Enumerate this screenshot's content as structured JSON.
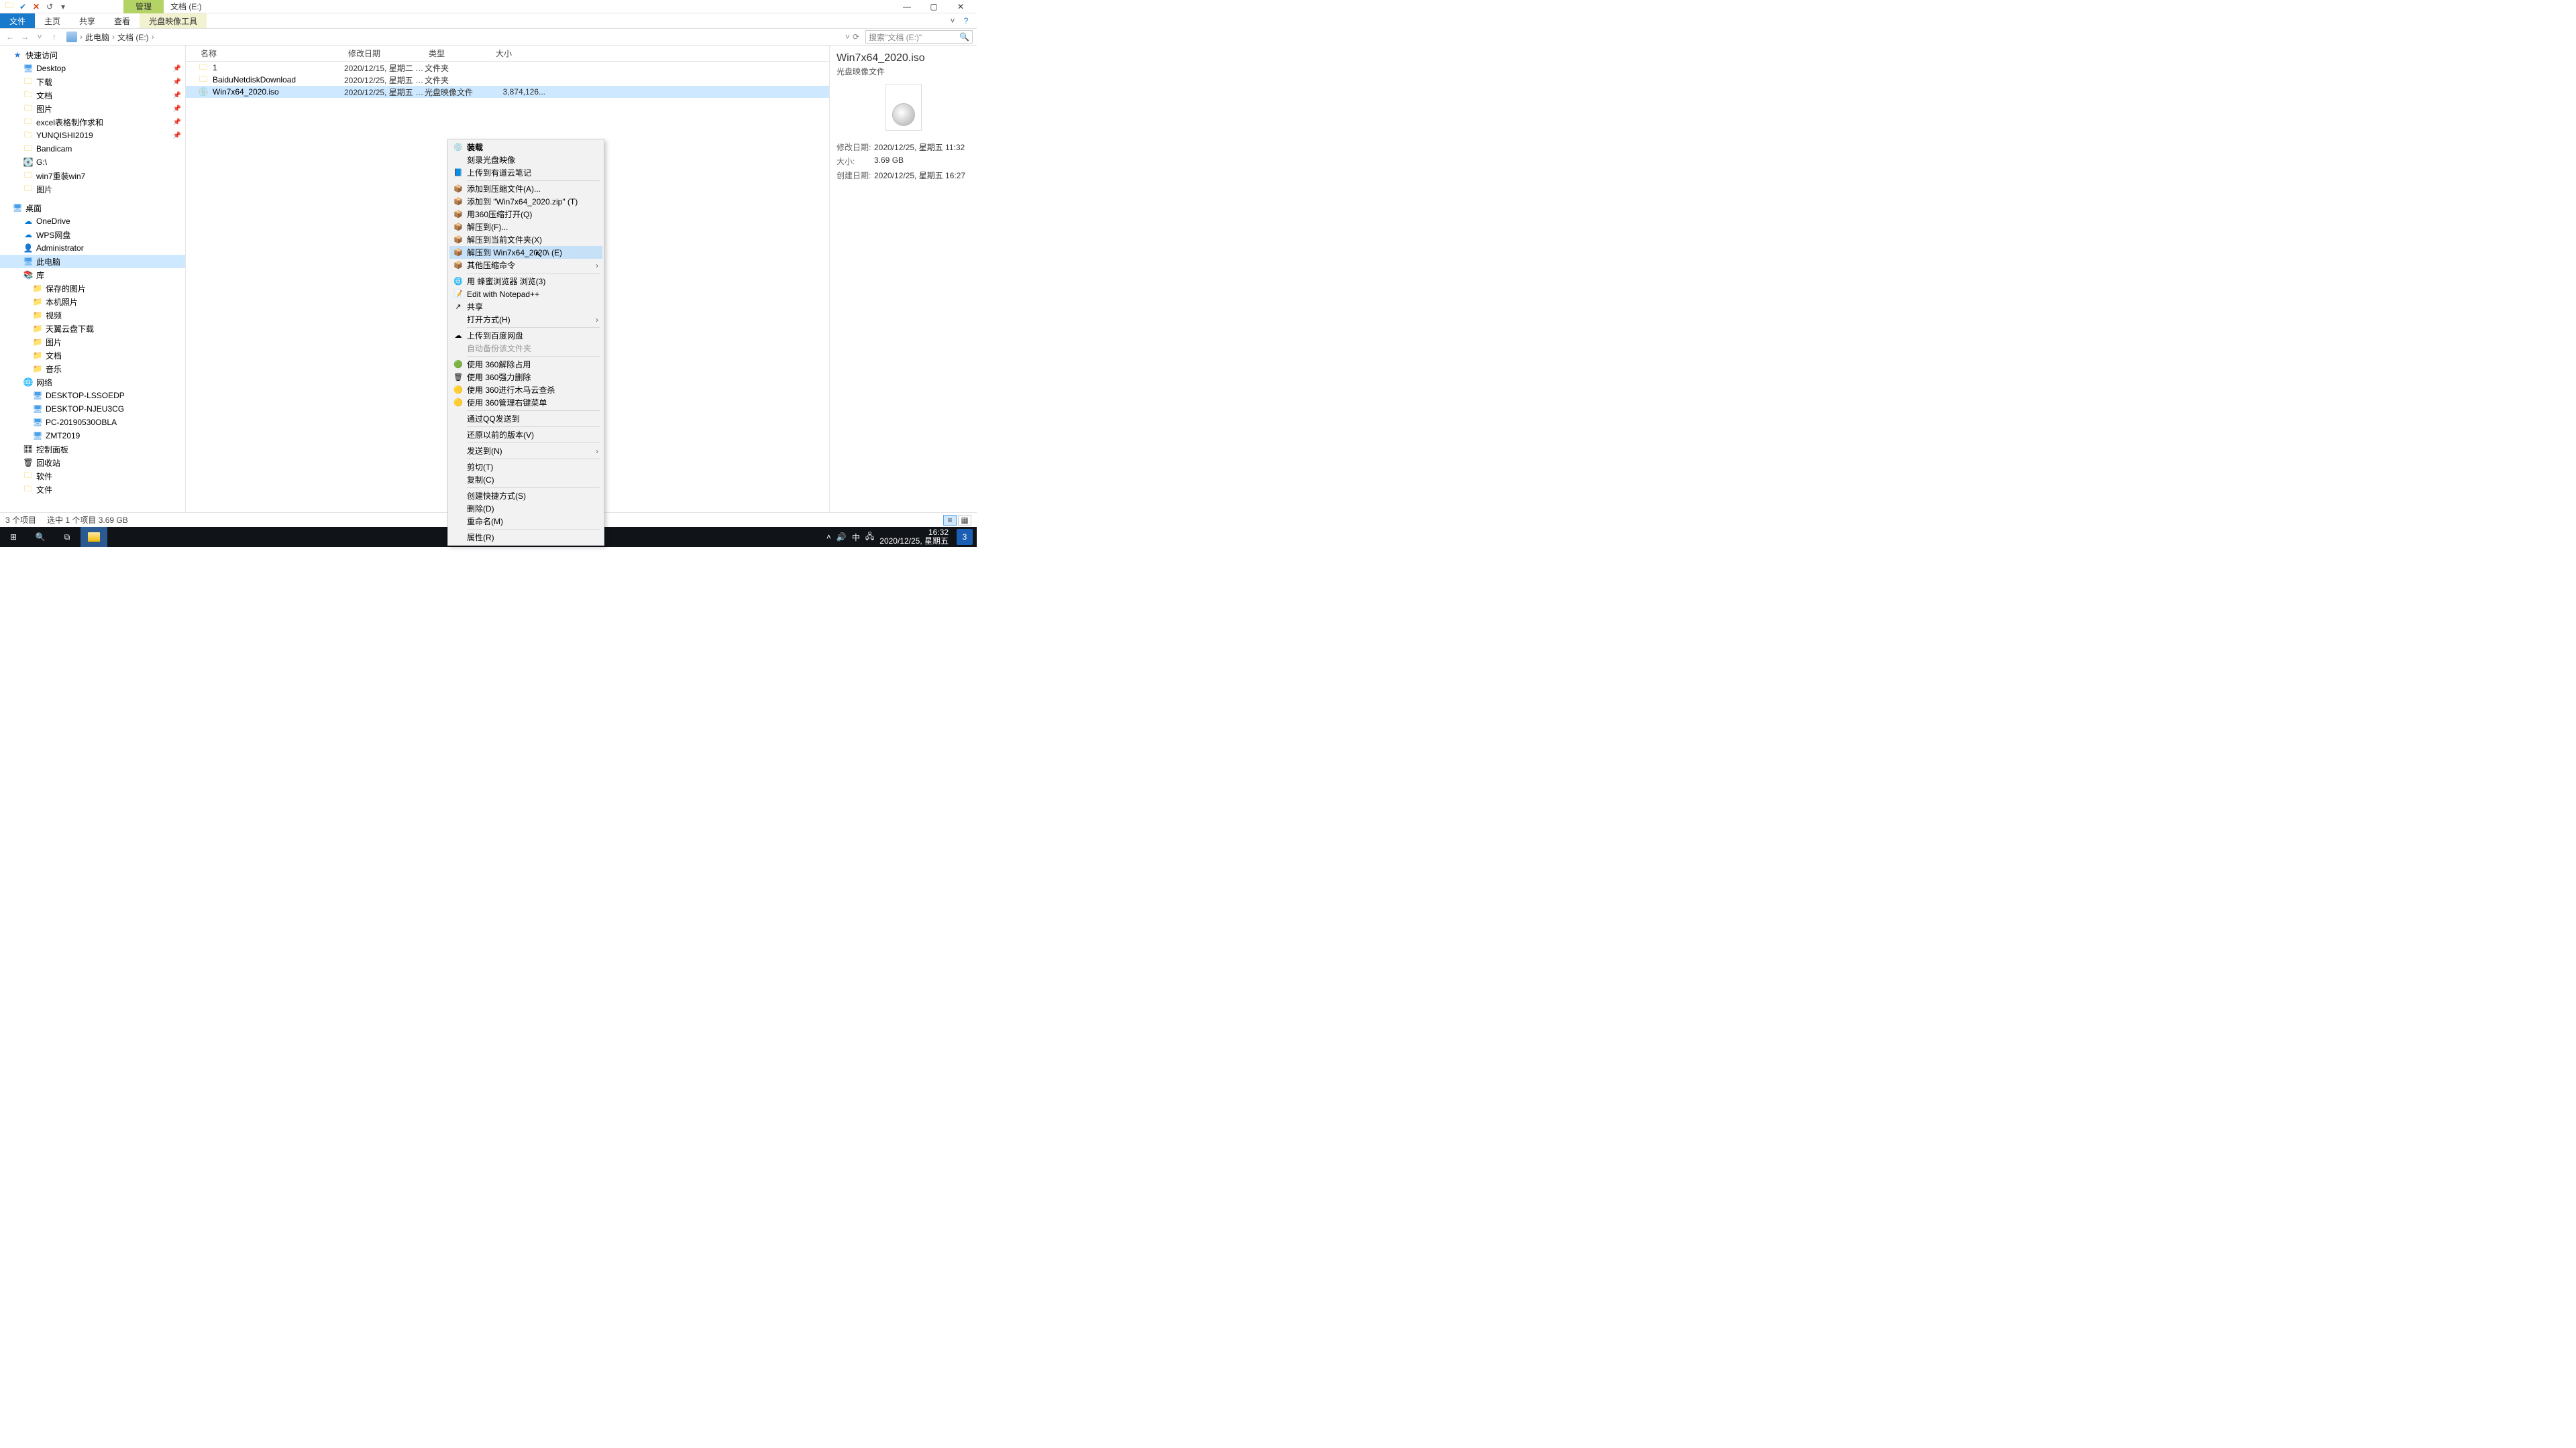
{
  "window": {
    "context_tab": "管理",
    "title": "文档 (E:)",
    "tabs": {
      "file": "文件",
      "home": "主页",
      "share": "共享",
      "view": "查看",
      "disc_tool": "光盘映像工具"
    }
  },
  "address": {
    "parts": [
      "此电脑",
      "文档 (E:)"
    ],
    "refresh": "⟳",
    "search_placeholder": "搜索\"文档 (E:)\""
  },
  "nav": {
    "quick": "快速访问",
    "quick_items": [
      {
        "icon": "desktop",
        "label": "Desktop",
        "pin": true
      },
      {
        "icon": "folder",
        "label": "下载",
        "pin": true
      },
      {
        "icon": "folder",
        "label": "文档",
        "pin": true
      },
      {
        "icon": "folder",
        "label": "图片",
        "pin": true
      },
      {
        "icon": "folder",
        "label": "excel表格制作求和",
        "pin": true
      },
      {
        "icon": "folder",
        "label": "YUNQISHI2019",
        "pin": true
      },
      {
        "icon": "folder",
        "label": "Bandicam"
      },
      {
        "icon": "disk",
        "label": "G:\\"
      },
      {
        "icon": "folder",
        "label": "win7重装win7"
      },
      {
        "icon": "folder",
        "label": "图片"
      }
    ],
    "desktop": "桌面",
    "desktop_items": [
      {
        "icon": "cloud",
        "label": "OneDrive"
      },
      {
        "icon": "cloud",
        "label": "WPS网盘"
      },
      {
        "icon": "user",
        "label": "Administrator"
      },
      {
        "icon": "monitor",
        "label": "此电脑",
        "selected": true
      },
      {
        "icon": "lib",
        "label": "库"
      }
    ],
    "lib_items": [
      {
        "label": "保存的图片"
      },
      {
        "label": "本机照片"
      },
      {
        "label": "视频"
      },
      {
        "label": "天翼云盘下载"
      },
      {
        "label": "图片"
      },
      {
        "label": "文档"
      },
      {
        "label": "音乐"
      }
    ],
    "net": "网络",
    "net_items": [
      {
        "label": "DESKTOP-LSSOEDP"
      },
      {
        "label": "DESKTOP-NJEU3CG"
      },
      {
        "label": "PC-20190530OBLA"
      },
      {
        "label": "ZMT2019"
      }
    ],
    "others": [
      {
        "icon": "panel",
        "label": "控制面板"
      },
      {
        "icon": "recycle",
        "label": "回收站"
      },
      {
        "icon": "folder",
        "label": "软件"
      },
      {
        "icon": "folder",
        "label": "文件"
      }
    ]
  },
  "columns": {
    "name": "名称",
    "date": "修改日期",
    "type": "类型",
    "size": "大小"
  },
  "rows": [
    {
      "icon": "folder",
      "name": "1",
      "date": "2020/12/15, 星期二 1...",
      "type": "文件夹",
      "size": ""
    },
    {
      "icon": "folder",
      "name": "BaiduNetdiskDownload",
      "date": "2020/12/25, 星期五 1...",
      "type": "文件夹",
      "size": ""
    },
    {
      "icon": "disc",
      "name": "Win7x64_2020.iso",
      "date": "2020/12/25, 星期五 1...",
      "type": "光盘映像文件",
      "size": "3,874,126...",
      "selected": true
    }
  ],
  "context_menu": {
    "groups": [
      [
        {
          "icon": "💿",
          "label": "装载",
          "bold": true
        },
        {
          "icon": "",
          "label": "刻录光盘映像"
        },
        {
          "icon": "📘",
          "label": "上传到有道云笔记"
        }
      ],
      [
        {
          "icon": "📦",
          "label": "添加到压缩文件(A)..."
        },
        {
          "icon": "📦",
          "label": "添加到 \"Win7x64_2020.zip\" (T)"
        },
        {
          "icon": "📦",
          "label": "用360压缩打开(Q)"
        },
        {
          "icon": "📦",
          "label": "解压到(F)..."
        },
        {
          "icon": "📦",
          "label": "解压到当前文件夹(X)"
        },
        {
          "icon": "📦",
          "label": "解压到 Win7x64_2020\\ (E)",
          "hover": true
        },
        {
          "icon": "📦",
          "label": "其他压缩命令",
          "submenu": true
        }
      ],
      [
        {
          "icon": "🌐",
          "label": "用 蜂蜜浏览器 浏览(3)"
        },
        {
          "icon": "📝",
          "label": "Edit with Notepad++"
        },
        {
          "icon": "↗",
          "label": "共享"
        },
        {
          "icon": "",
          "label": "打开方式(H)",
          "submenu": true
        }
      ],
      [
        {
          "icon": "☁",
          "label": "上传到百度网盘"
        },
        {
          "icon": "",
          "label": "自动备份该文件夹",
          "disabled": true
        }
      ],
      [
        {
          "icon": "🟢",
          "label": "使用 360解除占用"
        },
        {
          "icon": "🗑",
          "label": "使用 360强力删除"
        },
        {
          "icon": "🟡",
          "label": "使用 360进行木马云查杀"
        },
        {
          "icon": "🟡",
          "label": "使用 360管理右键菜单"
        }
      ],
      [
        {
          "icon": "",
          "label": "通过QQ发送到"
        }
      ],
      [
        {
          "icon": "",
          "label": "还原以前的版本(V)"
        }
      ],
      [
        {
          "icon": "",
          "label": "发送到(N)",
          "submenu": true
        }
      ],
      [
        {
          "icon": "",
          "label": "剪切(T)"
        },
        {
          "icon": "",
          "label": "复制(C)"
        }
      ],
      [
        {
          "icon": "",
          "label": "创建快捷方式(S)"
        },
        {
          "icon": "",
          "label": "删除(D)"
        },
        {
          "icon": "",
          "label": "重命名(M)"
        }
      ],
      [
        {
          "icon": "",
          "label": "属性(R)"
        }
      ]
    ]
  },
  "details": {
    "title": "Win7x64_2020.iso",
    "subtitle": "光盘映像文件",
    "rows": [
      {
        "label": "修改日期:",
        "val": "2020/12/25, 星期五 11:32"
      },
      {
        "label": "大小:",
        "val": "3.69 GB"
      },
      {
        "label": "创建日期:",
        "val": "2020/12/25, 星期五 16:27"
      }
    ]
  },
  "status": {
    "count": "3 个项目",
    "sel": "选中 1 个项目  3.69 GB"
  },
  "taskbar": {
    "ime": "中",
    "time": "16:32",
    "date": "2020/12/25, 星期五",
    "notif": "3"
  }
}
